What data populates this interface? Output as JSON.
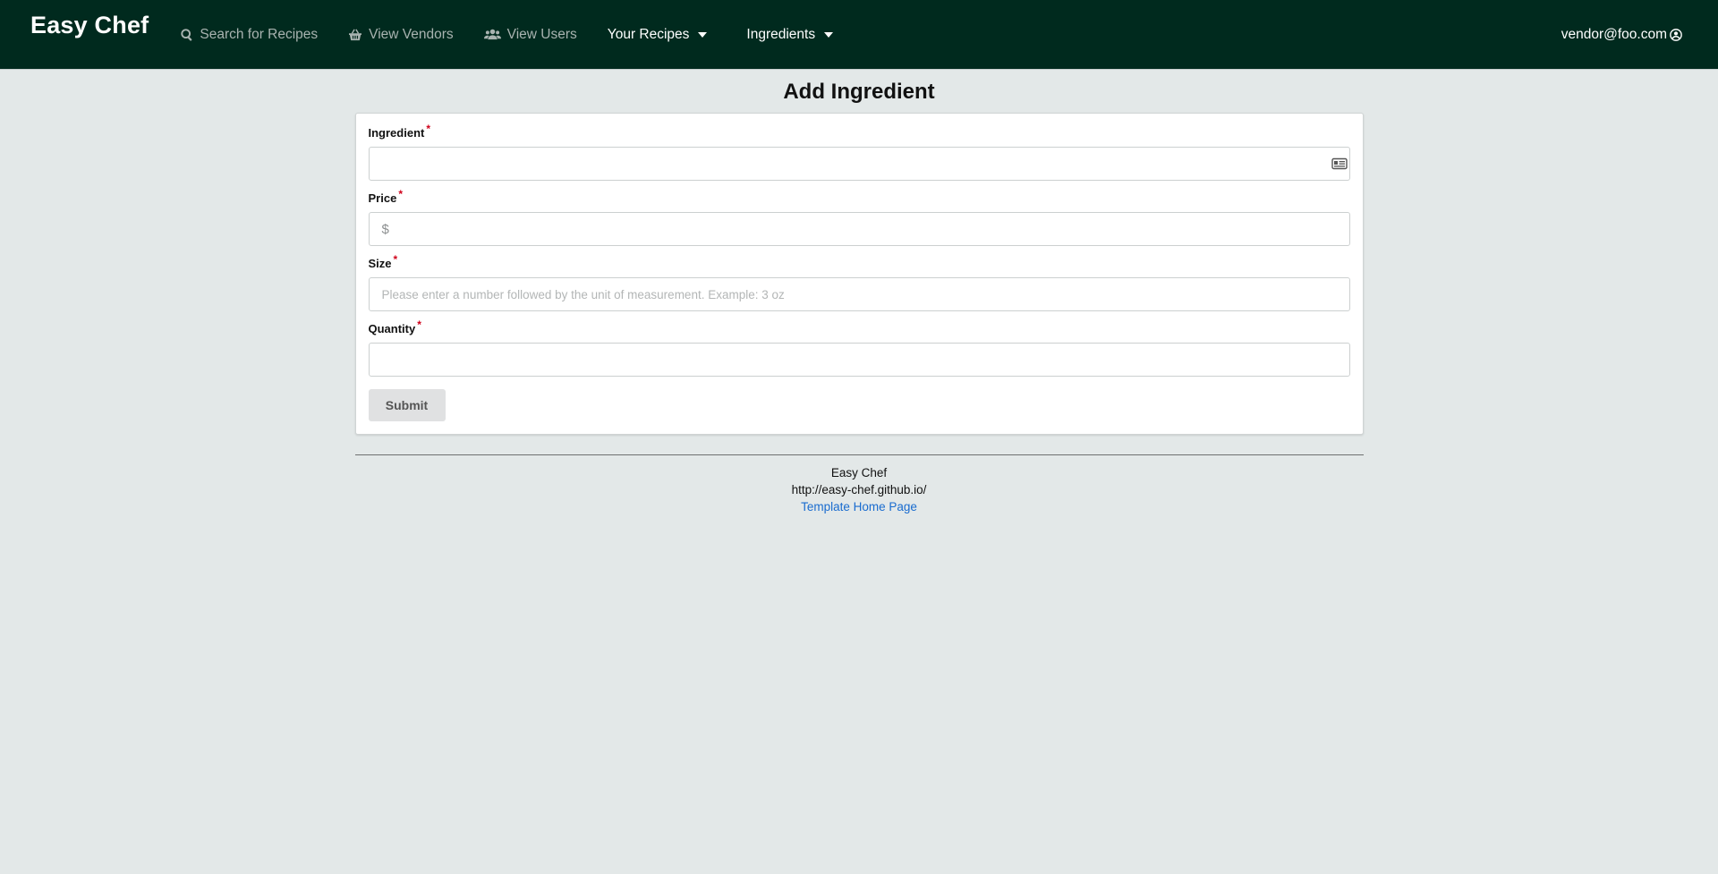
{
  "navbar": {
    "brand": "Easy Chef",
    "items": [
      {
        "label": "Search for Recipes",
        "icon": "search-icon"
      },
      {
        "label": "View Vendors",
        "icon": "basket-icon"
      },
      {
        "label": "View Users",
        "icon": "users-icon"
      }
    ],
    "dropdowns": [
      {
        "label": "Your Recipes"
      },
      {
        "label": "Ingredients"
      }
    ],
    "user": "vendor@foo.com"
  },
  "page": {
    "title": "Add Ingredient"
  },
  "form": {
    "ingredient": {
      "label": "Ingredient",
      "value": "",
      "placeholder": ""
    },
    "price": {
      "label": "Price",
      "prefix": "$",
      "value": "",
      "placeholder": ""
    },
    "size": {
      "label": "Size",
      "value": "",
      "placeholder": "Please enter a number followed by the unit of measurement. Example: 3 oz"
    },
    "quantity": {
      "label": "Quantity",
      "value": "",
      "placeholder": ""
    },
    "required_marker": "*",
    "submit_label": "Submit"
  },
  "footer": {
    "line1": "Easy Chef",
    "line2": "http://easy-chef.github.io/",
    "link": "Template Home Page"
  },
  "colors": {
    "navbar_bg": "#002a1e",
    "page_bg": "#e3e8e8",
    "link": "#1a6ccf",
    "required": "#d0021b"
  }
}
